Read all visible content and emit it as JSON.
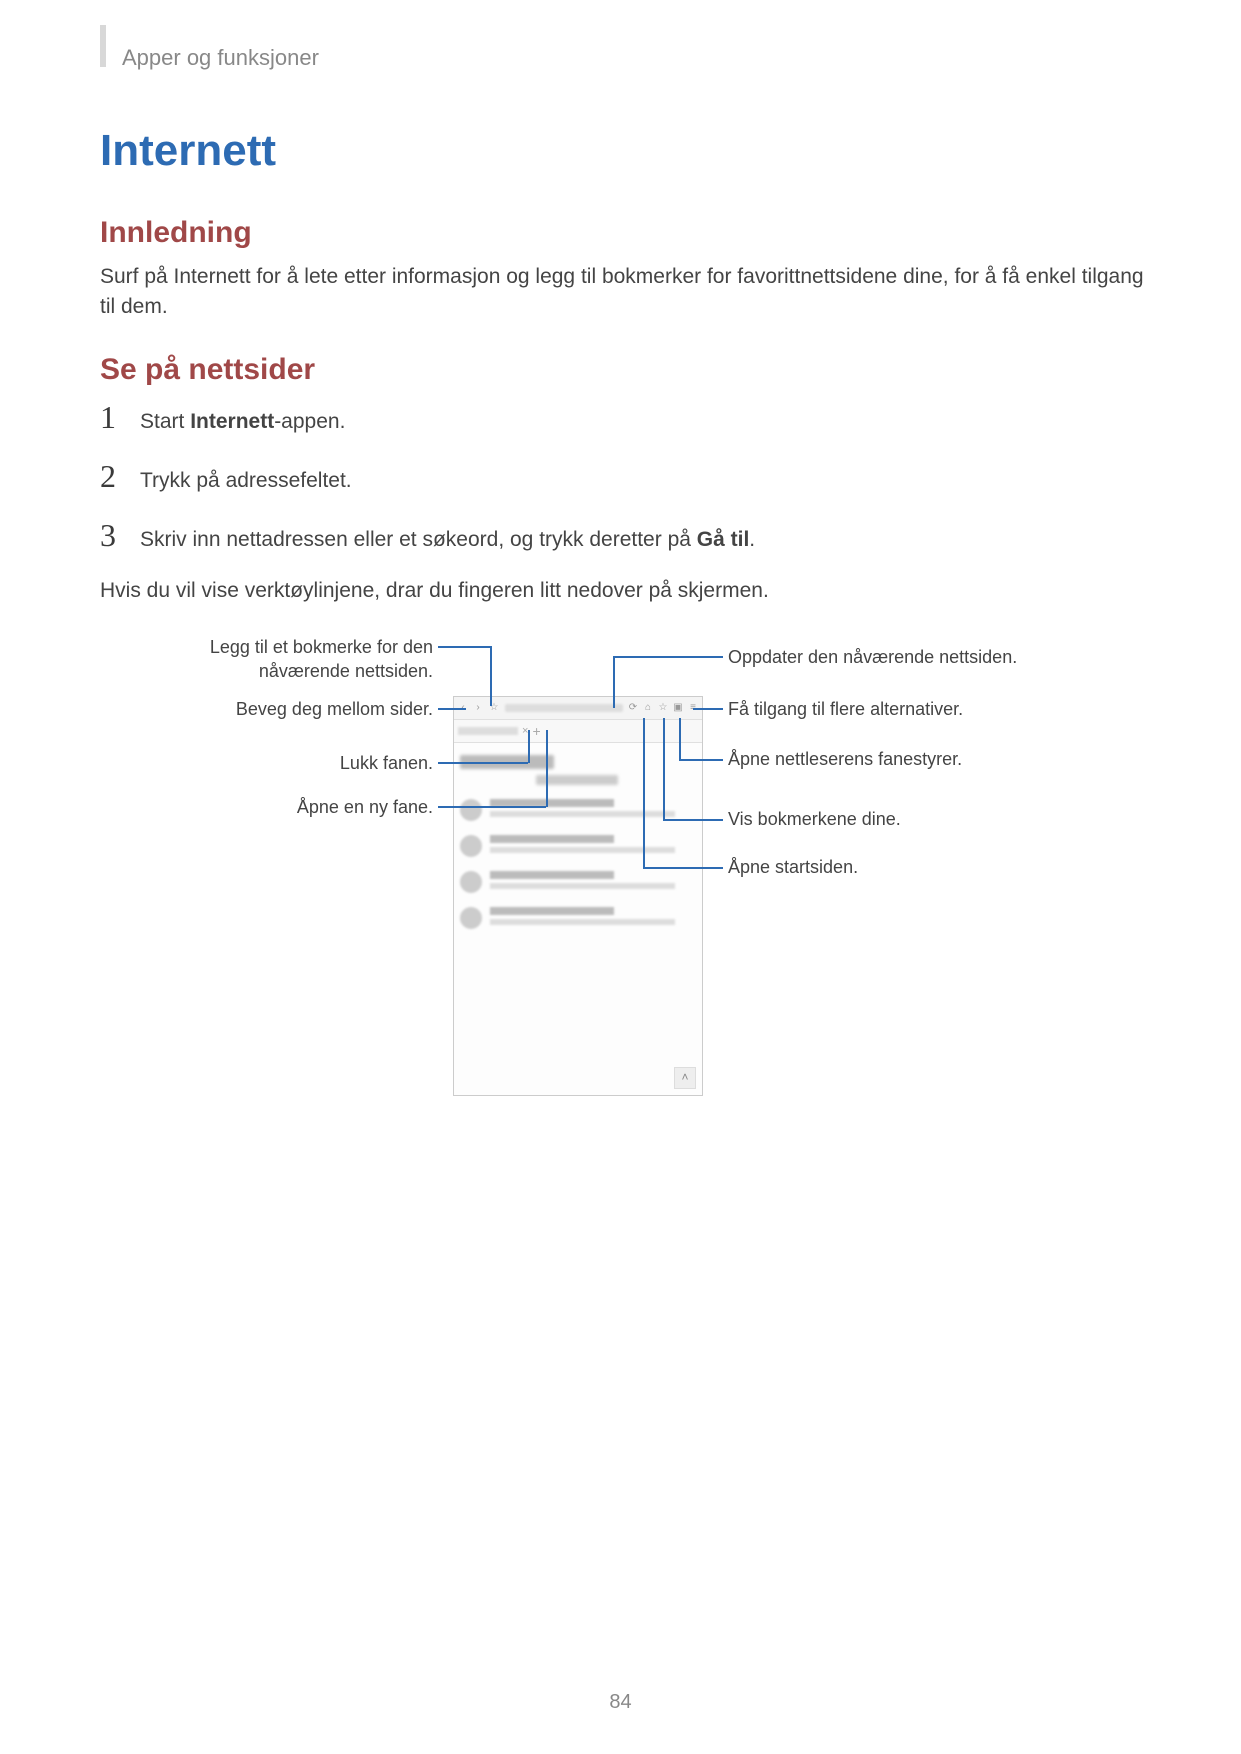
{
  "header": {
    "breadcrumb": "Apper og funksjoner"
  },
  "title": "Internett",
  "section_intro": {
    "heading": "Innledning",
    "body": "Surf på Internett for å lete etter informasjon og legg til bokmerker for favorittnettsidene dine, for å få enkel tilgang til dem."
  },
  "section_browse": {
    "heading": "Se på nettsider",
    "steps": [
      {
        "num": "1",
        "pre": "Start ",
        "bold": "Internett",
        "post": "-appen."
      },
      {
        "num": "2",
        "pre": "Trykk på adressefeltet.",
        "bold": "",
        "post": ""
      },
      {
        "num": "3",
        "pre": "Skriv inn nettadressen eller et søkeord, og trykk deretter på ",
        "bold": "Gå til",
        "post": "."
      }
    ],
    "note": "Hvis du vil vise verktøylinjene, drar du fingeren litt nedover på skjermen."
  },
  "callouts": {
    "left": [
      "Legg til et bokmerke for den nåværende nettsiden.",
      "Beveg deg mellom sider.",
      "Lukk fanen.",
      "Åpne en ny fane."
    ],
    "right": [
      "Oppdater den nåværende nettsiden.",
      "Få tilgang til flere alternativer.",
      "Åpne nettleserens fanestyrer.",
      "Vis bokmerkene dine.",
      "Åpne startsiden."
    ]
  },
  "icons": {
    "back": "‹",
    "forward": "›",
    "star": "☆",
    "refresh": "⟳",
    "home": "⌂",
    "bookmark": "☆",
    "tabs": "▣",
    "menu": "≡",
    "close": "×",
    "plus": "+",
    "up": "˄"
  },
  "page_number": "84"
}
